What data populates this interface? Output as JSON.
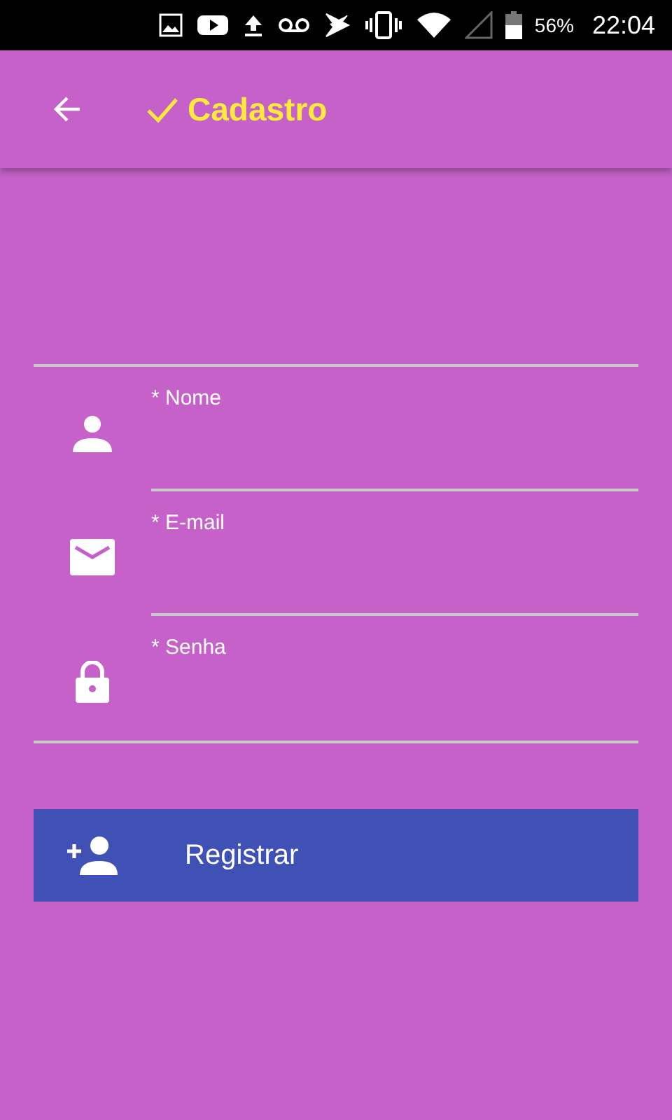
{
  "status_bar": {
    "battery": "56%",
    "time": "22:04"
  },
  "app_bar": {
    "title": "Cadastro"
  },
  "fields": [
    {
      "kind": "person",
      "label": "* Nome"
    },
    {
      "kind": "email",
      "label": "* E-mail"
    },
    {
      "kind": "lock",
      "label": "* Senha"
    }
  ],
  "register_button": {
    "label": "Registrar"
  }
}
